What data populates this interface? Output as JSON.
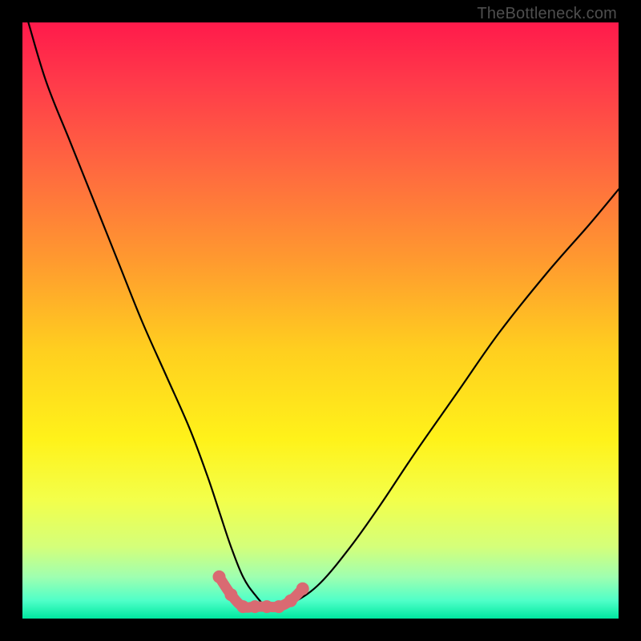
{
  "watermark": {
    "text": "TheBottleneck.com"
  },
  "colors": {
    "frame": "#000000",
    "curve": "#000000",
    "flat_marker": "#d96a72",
    "gradient_stops": [
      {
        "offset": 0.0,
        "color": "#ff1a4b"
      },
      {
        "offset": 0.1,
        "color": "#ff3a4a"
      },
      {
        "offset": 0.25,
        "color": "#ff6a3f"
      },
      {
        "offset": 0.4,
        "color": "#ff9a2f"
      },
      {
        "offset": 0.55,
        "color": "#ffcf1f"
      },
      {
        "offset": 0.7,
        "color": "#fff21a"
      },
      {
        "offset": 0.8,
        "color": "#f3ff4a"
      },
      {
        "offset": 0.88,
        "color": "#d4ff7a"
      },
      {
        "offset": 0.93,
        "color": "#9fffb0"
      },
      {
        "offset": 0.97,
        "color": "#4fffc8"
      },
      {
        "offset": 1.0,
        "color": "#00e8a0"
      }
    ]
  },
  "chart_data": {
    "type": "line",
    "title": "",
    "xlabel": "",
    "ylabel": "",
    "xlim": [
      0,
      100
    ],
    "ylim": [
      0,
      100
    ],
    "grid": false,
    "series": [
      {
        "name": "bottleneck-curve",
        "x": [
          1,
          4,
          8,
          12,
          16,
          20,
          24,
          28,
          31,
          33,
          35,
          37,
          39,
          41,
          43,
          46,
          50,
          55,
          60,
          66,
          73,
          80,
          88,
          95,
          100
        ],
        "values": [
          100,
          90,
          80,
          70,
          60,
          50,
          41,
          32,
          24,
          18,
          12,
          7,
          4,
          2,
          2,
          3,
          6,
          12,
          19,
          28,
          38,
          48,
          58,
          66,
          72
        ]
      },
      {
        "name": "optimal-flat-region",
        "x": [
          33,
          35,
          37,
          39,
          41,
          43,
          45,
          47
        ],
        "values": [
          7,
          4,
          2,
          2,
          2,
          2,
          3,
          5
        ]
      }
    ]
  }
}
